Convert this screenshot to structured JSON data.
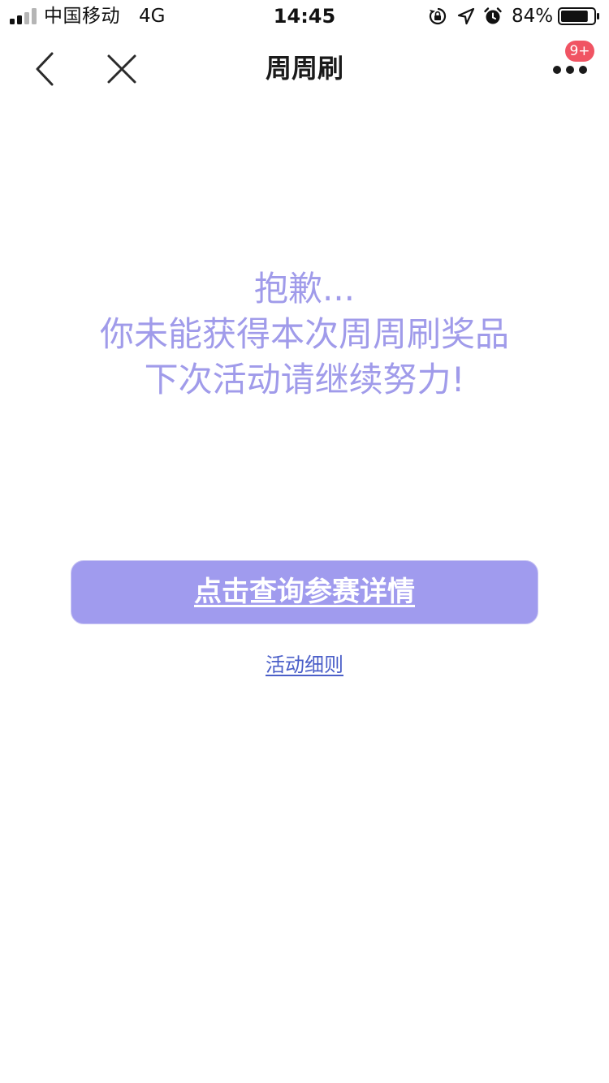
{
  "status_bar": {
    "carrier": "中国移动",
    "network": "4G",
    "time": "14:45",
    "battery_percent": "84%",
    "battery_level": 0.84,
    "signal_bars_active": 2,
    "signal_bars_total": 4,
    "icons": [
      "signal-icon",
      "rotation-lock-icon",
      "location-arrow-icon",
      "alarm-icon",
      "battery-icon"
    ]
  },
  "nav": {
    "title": "周周刷",
    "badge": "9+",
    "icons": [
      "back-chevron-icon",
      "close-icon",
      "more-dots-icon"
    ]
  },
  "message": {
    "line1": "抱歉...",
    "line2": "你未能获得本次周周刷奖品",
    "line3": "下次活动请继续努力!"
  },
  "actions": {
    "query_label": "点击查询参赛详情",
    "rules_label": "活动细则"
  },
  "colors": {
    "accent": "#a09bee",
    "message_text": "#a09bea",
    "link": "#4a5ec8",
    "badge": "#f05463"
  }
}
